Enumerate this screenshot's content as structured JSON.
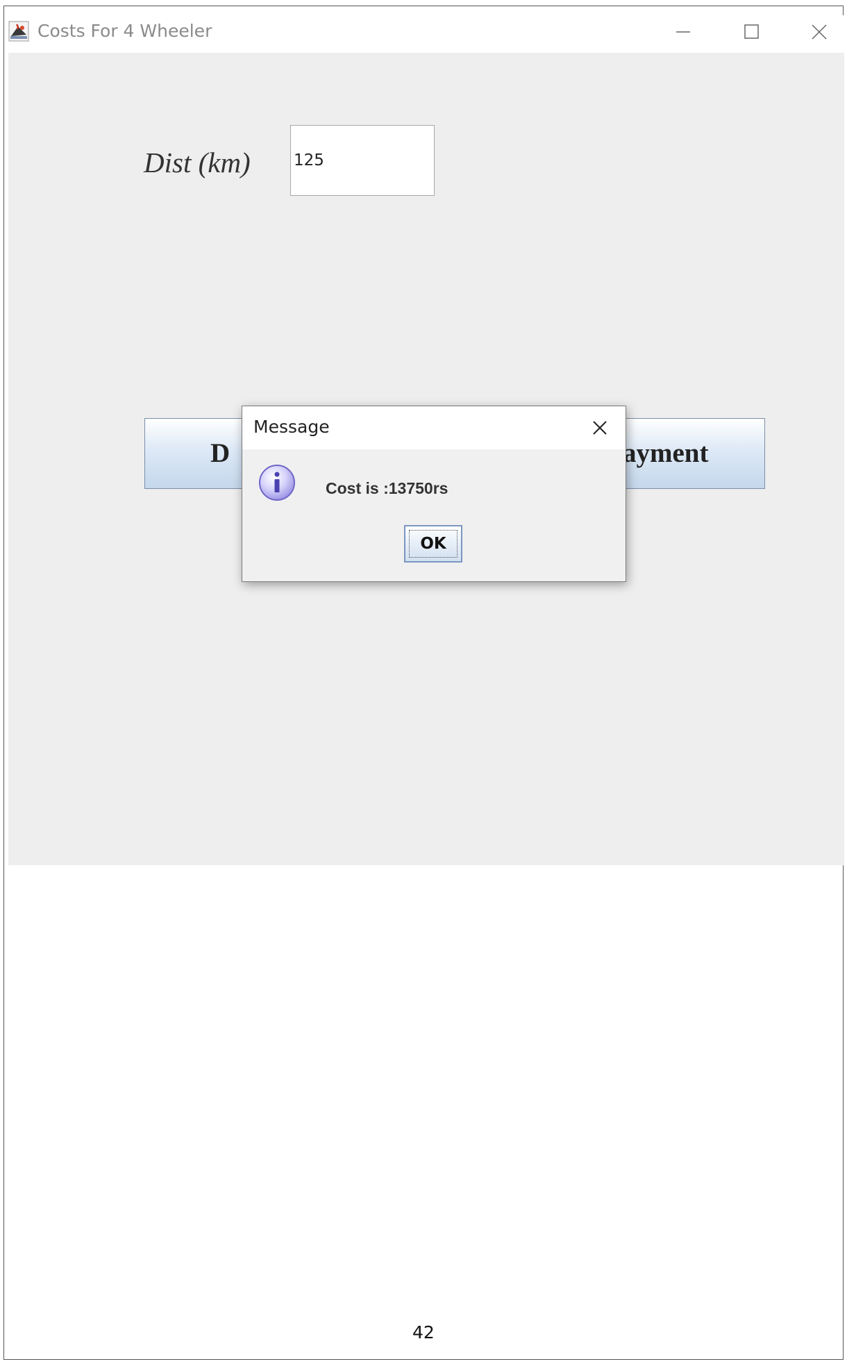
{
  "window": {
    "title": "Costs For 4 Wheeler",
    "icon": "java-cup-icon"
  },
  "form": {
    "dist_label": "Dist (km)",
    "dist_value": "125",
    "left_button_label_visible": "D",
    "right_button_label_visible": "ayment"
  },
  "dialog": {
    "title": "Message",
    "message": "Cost is :13750rs",
    "ok_label": "OK",
    "icon": "info-icon"
  },
  "page": {
    "number": "42"
  },
  "colors": {
    "content_bg": "#eeeeee",
    "button_gradient_top": "#ffffff",
    "button_gradient_bottom": "#c5d7ec",
    "info_icon": "#b9b3f0"
  }
}
